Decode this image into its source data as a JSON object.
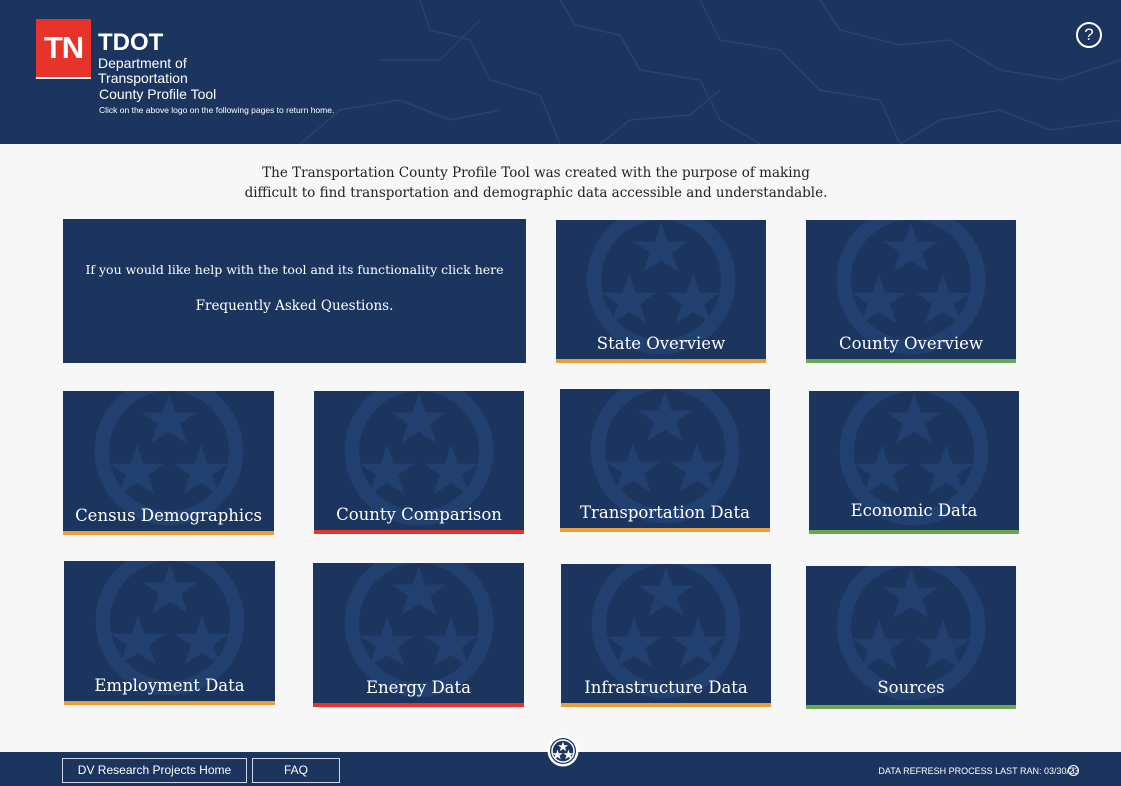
{
  "header": {
    "logo_text": "TN",
    "org_abbr": "TDOT",
    "org_line1": "Department of",
    "org_line2": "Transportation",
    "tool_name": "County Profile Tool",
    "hint": "Click on the above logo on the following pages to return home.",
    "help_symbol": "?"
  },
  "intro": {
    "line1": "The Transportation County Profile Tool was created with the purpose of making",
    "line2": "difficult to find transportation and demographic data accessible and understandable."
  },
  "faq_tile": {
    "help_text": "If you would like help with the tool and its functionality click here",
    "link_text": "Frequently Asked Questions."
  },
  "tiles": [
    {
      "label": "State Overview",
      "accent": "#e8a13a"
    },
    {
      "label": "County Overview",
      "accent": "#6aa84f"
    },
    {
      "label": "Census Demographics",
      "accent": "#e8a13a"
    },
    {
      "label": "County Comparison",
      "accent": "#e8332a"
    },
    {
      "label": "Transportation Data",
      "accent": "#e8a13a"
    },
    {
      "label": "Economic Data",
      "accent": "#6aa84f"
    },
    {
      "label": "Employment Data",
      "accent": "#e8a13a"
    },
    {
      "label": "Energy Data",
      "accent": "#e8332a"
    },
    {
      "label": "Infrastructure Data",
      "accent": "#e8a13a"
    },
    {
      "label": "Sources",
      "accent": "#6aa84f"
    }
  ],
  "footer": {
    "home_button": "DV Research Projects Home",
    "faq_button": "FAQ",
    "refresh_label": "DATA REFRESH PROCESS LAST RAN: 03/30/23",
    "info_symbol": "i"
  },
  "colors": {
    "navy": "#1b355f",
    "logo_red": "#e8332a",
    "accent_orange": "#e8a13a",
    "accent_green": "#6aa84f",
    "accent_red": "#e8332a"
  },
  "icons": {
    "help": "question-circle-icon",
    "tile_emblem": "tri-star-emblem-icon",
    "footer_emblem": "tri-star-seal-icon",
    "info": "info-circle-icon"
  }
}
